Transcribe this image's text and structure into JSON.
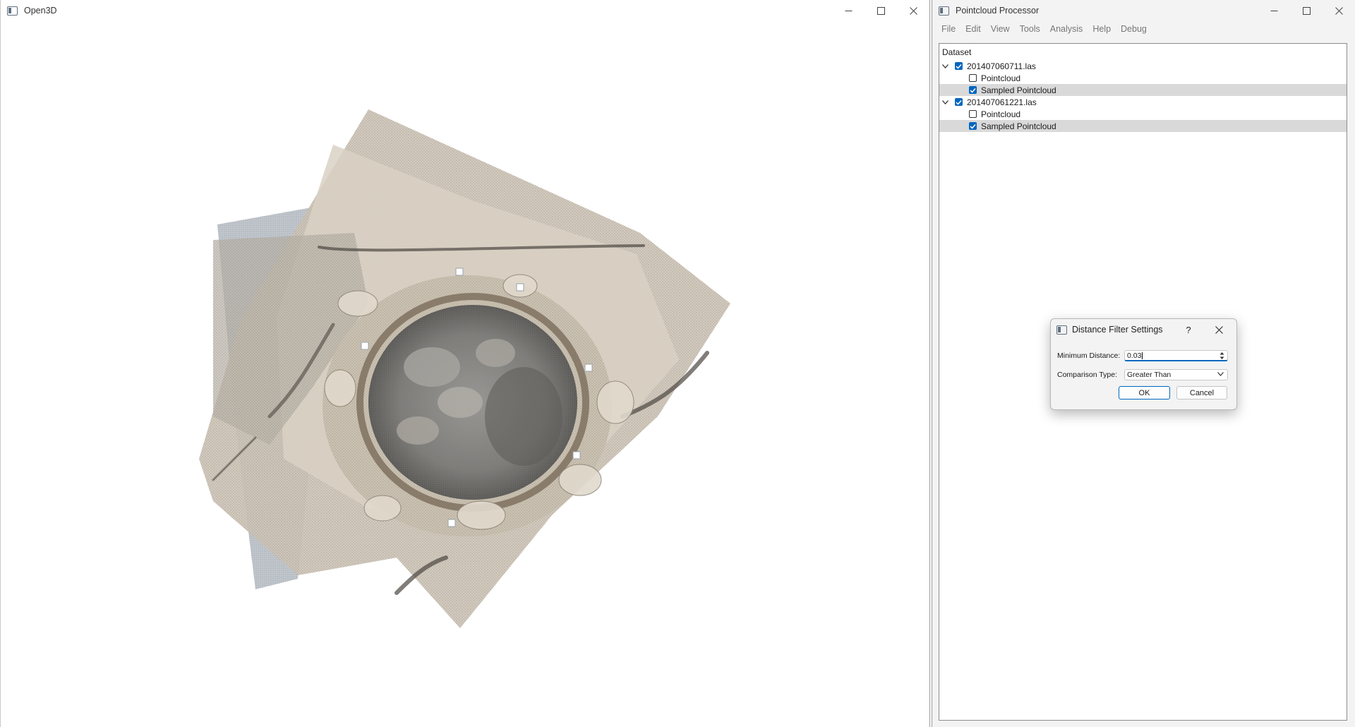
{
  "open3d_window": {
    "title": "Open3D"
  },
  "processor_window": {
    "title": "Pointcloud Processor",
    "menu": [
      "File",
      "Edit",
      "View",
      "Tools",
      "Analysis",
      "Help",
      "Debug"
    ],
    "tree": {
      "header": "Dataset",
      "rows": [
        {
          "label": "201407060711.las",
          "level": 0,
          "checked": true,
          "expanded": true,
          "selected": false
        },
        {
          "label": "Pointcloud",
          "level": 1,
          "checked": false,
          "selected": false
        },
        {
          "label": "Sampled Pointcloud",
          "level": 1,
          "checked": true,
          "selected": true
        },
        {
          "label": "201407061221.las",
          "level": 0,
          "checked": true,
          "expanded": true,
          "selected": false
        },
        {
          "label": "Pointcloud",
          "level": 1,
          "checked": false,
          "selected": false
        },
        {
          "label": "Sampled Pointcloud",
          "level": 1,
          "checked": true,
          "selected": true
        }
      ]
    }
  },
  "dialog": {
    "title": "Distance Filter Settings",
    "help_glyph": "?",
    "min_distance_label": "Minimum Distance:",
    "min_distance_value": "0.03",
    "comparison_label": "Comparison Type:",
    "comparison_value": "Greater Than",
    "ok_label": "OK",
    "cancel_label": "Cancel"
  },
  "colors": {
    "accent": "#0067c0",
    "selection": "#d9d9d9",
    "panel_bg": "#f3f3f3"
  }
}
